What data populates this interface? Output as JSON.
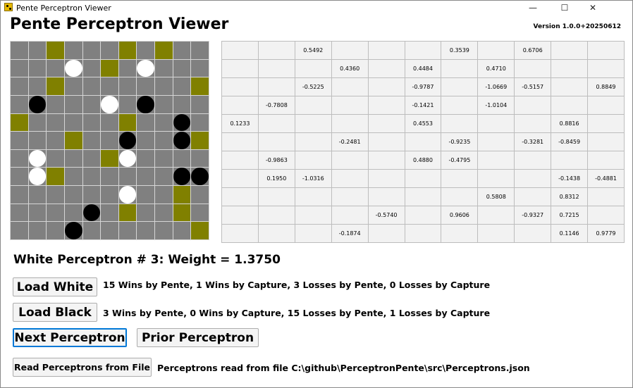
{
  "window": {
    "title": "Pente Perceptron Viewer",
    "controls": {
      "minimize": "—",
      "maximize": "☐",
      "close": "✕"
    }
  },
  "header": {
    "title": "Pente Perceptron Viewer",
    "version": "Version 1.0.0+20250612"
  },
  "board": {
    "size": 11,
    "colors": {
      "empty": "#808080",
      "highlight": "#808000",
      "white_stone": "#ffffff",
      "black_stone": "#000000"
    },
    "rows": [
      "..O...O.O..",
      "...W.O.W...",
      "..O.......O",
      ".B...W.B...",
      "O.....O..B.",
      "...O..B..BO",
      ".W...OW....",
      ".WO......BB",
      "......W..O.",
      "....B.O..O.",
      "...B......O"
    ]
  },
  "weights_table": {
    "rows": [
      [
        "",
        "",
        "0.5492",
        "",
        "",
        "",
        "0.3539",
        "",
        "0.6706",
        "",
        ""
      ],
      [
        "",
        "",
        "",
        "0.4360",
        "",
        "0.4484",
        "",
        "0.4710",
        "",
        "",
        ""
      ],
      [
        "",
        "",
        "-0.5225",
        "",
        "",
        "-0.9787",
        "",
        "-1.0669",
        "-0.5157",
        "",
        "0.8849"
      ],
      [
        "",
        "-0.7808",
        "",
        "",
        "",
        "-0.1421",
        "",
        "-1.0104",
        "",
        "",
        ""
      ],
      [
        "0.1233",
        "",
        "",
        "",
        "",
        "0.4553",
        "",
        "",
        "",
        "0.8816",
        ""
      ],
      [
        "",
        "",
        "",
        "-0.2481",
        "",
        "",
        "-0.9235",
        "",
        "-0.3281",
        "-0.8459",
        ""
      ],
      [
        "",
        "-0.9863",
        "",
        "",
        "",
        "0.4880",
        "-0.4795",
        "",
        "",
        "",
        ""
      ],
      [
        "",
        "0.1950",
        "-1.0316",
        "",
        "",
        "",
        "",
        "",
        "",
        "-0.1438",
        "-0.4881"
      ],
      [
        "",
        "",
        "",
        "",
        "",
        "",
        "",
        "0.5808",
        "",
        "0.8312",
        ""
      ],
      [
        "",
        "",
        "",
        "",
        "-0.5740",
        "",
        "0.9606",
        "",
        "-0.9327",
        "0.7215",
        ""
      ],
      [
        "",
        "",
        "",
        "-0.1874",
        "",
        "",
        "",
        "",
        "",
        "0.1146",
        "0.9779"
      ]
    ]
  },
  "perceptron": {
    "title": "White Perceptron # 3: Weight = 1.3750"
  },
  "controls": {
    "load_white": {
      "label": "Load White",
      "stats": "15 Wins by Pente, 1 Wins by Capture, 3 Losses by Pente, 0 Losses by Capture"
    },
    "load_black": {
      "label": "Load Black",
      "stats": "3 Wins by Pente, 0 Wins by Capture, 15 Losses by Pente, 1 Losses by Capture"
    },
    "next": {
      "label": "Next Perceptron"
    },
    "prior": {
      "label": "Prior Perceptron"
    },
    "read_file": {
      "label": "Read Perceptrons from File",
      "status": "Perceptrons read from file C:\\github\\PerceptronPente\\src\\Perceptrons.json"
    }
  }
}
